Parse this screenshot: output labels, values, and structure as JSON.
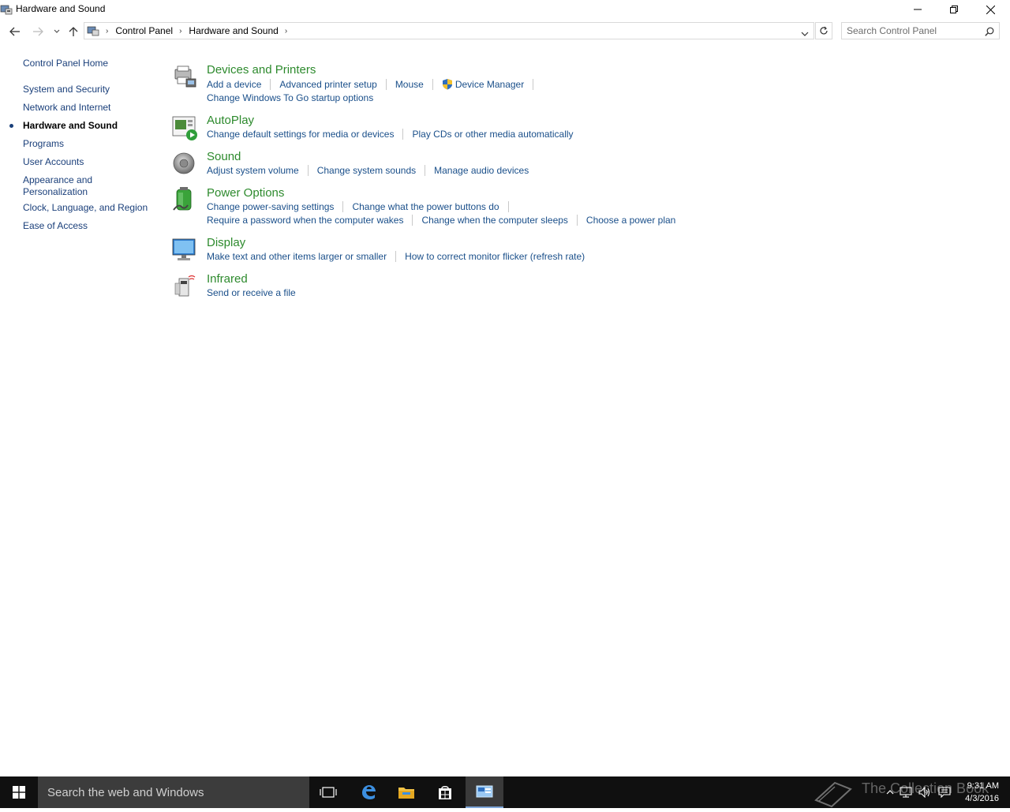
{
  "window": {
    "title": "Hardware and Sound"
  },
  "address": {
    "crumbs": [
      "Control Panel",
      "Hardware and Sound"
    ],
    "search_placeholder": "Search Control Panel"
  },
  "leftnav": {
    "items": [
      {
        "label": "Control Panel Home",
        "active": false
      },
      {
        "label": "System and Security",
        "active": false
      },
      {
        "label": "Network and Internet",
        "active": false
      },
      {
        "label": "Hardware and Sound",
        "active": true
      },
      {
        "label": "Programs",
        "active": false
      },
      {
        "label": "User Accounts",
        "active": false
      },
      {
        "label": "Appearance and Personalization",
        "active": false
      },
      {
        "label": "Clock, Language, and Region",
        "active": false
      },
      {
        "label": "Ease of Access",
        "active": false
      }
    ]
  },
  "categories": [
    {
      "title": "Devices and Printers",
      "icon": "devices-printers-icon",
      "links": [
        "Add a device",
        "Advanced printer setup",
        "Mouse",
        "Device Manager",
        "Change Windows To Go startup options"
      ]
    },
    {
      "title": "AutoPlay",
      "icon": "autoplay-icon",
      "links": [
        "Change default settings for media or devices",
        "Play CDs or other media automatically"
      ]
    },
    {
      "title": "Sound",
      "icon": "speaker-icon",
      "links": [
        "Adjust system volume",
        "Change system sounds",
        "Manage audio devices"
      ]
    },
    {
      "title": "Power Options",
      "icon": "battery-icon",
      "links": [
        "Change power-saving settings",
        "Change what the power buttons do",
        "Require a password when the computer wakes",
        "Change when the computer sleeps",
        "Choose a power plan"
      ]
    },
    {
      "title": "Display",
      "icon": "monitor-icon",
      "links": [
        "Make text and other items larger or smaller",
        "How to correct monitor flicker (refresh rate)"
      ]
    },
    {
      "title": "Infrared",
      "icon": "infrared-icon",
      "links": [
        "Send or receive a file"
      ]
    }
  ],
  "taskbar": {
    "search_text": "Search the web and Windows",
    "time": "9:31 AM",
    "date": "4/3/2016",
    "watermark": "The Collection Book"
  },
  "colors": {
    "category_title": "#2d8a2d",
    "link": "#1a4f8a",
    "taskbar": "#101010"
  }
}
